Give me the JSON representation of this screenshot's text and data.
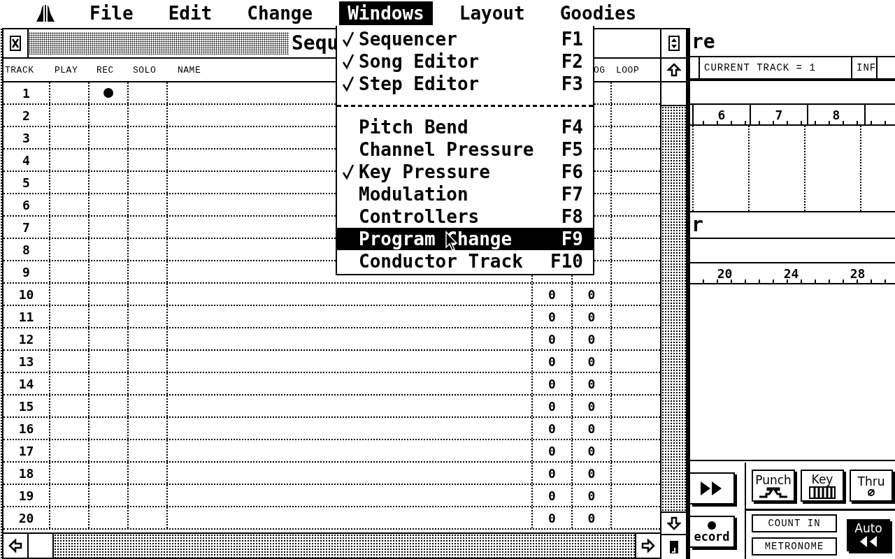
{
  "menubar": {
    "items": [
      {
        "label": "File",
        "selected": false
      },
      {
        "label": "Edit",
        "selected": false
      },
      {
        "label": "Change",
        "selected": false
      },
      {
        "label": "Windows",
        "selected": true
      },
      {
        "label": "Layout",
        "selected": false
      },
      {
        "label": "Goodies",
        "selected": false
      }
    ]
  },
  "windows_menu": {
    "items": [
      {
        "kind": "item",
        "label": "Sequencer",
        "shortcut": "F1",
        "checked": true,
        "selected": false
      },
      {
        "kind": "item",
        "label": "Song Editor",
        "shortcut": "F2",
        "checked": true,
        "selected": false
      },
      {
        "kind": "item",
        "label": "Step Editor",
        "shortcut": "F3",
        "checked": true,
        "selected": false
      },
      {
        "kind": "separator"
      },
      {
        "kind": "item",
        "label": "Pitch Bend",
        "shortcut": "F4",
        "checked": false,
        "selected": false
      },
      {
        "kind": "item",
        "label": "Channel Pressure",
        "shortcut": "F5",
        "checked": false,
        "selected": false
      },
      {
        "kind": "item",
        "label": "Key Pressure",
        "shortcut": "F6",
        "checked": true,
        "selected": false
      },
      {
        "kind": "item",
        "label": "Modulation",
        "shortcut": "F7",
        "checked": false,
        "selected": false
      },
      {
        "kind": "item",
        "label": "Controllers",
        "shortcut": "F8",
        "checked": false,
        "selected": false
      },
      {
        "kind": "item",
        "label": "Program Change",
        "shortcut": "F9",
        "checked": false,
        "selected": true
      },
      {
        "kind": "item",
        "label": "Conductor Track",
        "shortcut": "F10",
        "checked": false,
        "selected": false
      }
    ]
  },
  "sequencer": {
    "title": "Sequ",
    "headers": {
      "track": "TRACK",
      "play": "PLAY",
      "rec": "REC",
      "solo": "SOLO",
      "name": "NAME",
      "column_7": "OG",
      "loop": "LOOP"
    },
    "rows": [
      {
        "track": "1",
        "rec": true
      },
      {
        "track": "2",
        "rec": false
      },
      {
        "track": "3",
        "rec": false
      },
      {
        "track": "4",
        "rec": false
      },
      {
        "track": "5",
        "rec": false
      },
      {
        "track": "6",
        "rec": false
      },
      {
        "track": "7",
        "rec": false
      },
      {
        "track": "8",
        "rec": false
      },
      {
        "track": "9",
        "rec": false
      },
      {
        "track": "10",
        "rec": false,
        "column_6": "0",
        "column_7": "0"
      },
      {
        "track": "11",
        "rec": false,
        "column_6": "0",
        "column_7": "0"
      },
      {
        "track": "12",
        "rec": false,
        "column_6": "0",
        "column_7": "0"
      },
      {
        "track": "13",
        "rec": false,
        "column_6": "0",
        "column_7": "0"
      },
      {
        "track": "14",
        "rec": false,
        "column_6": "0",
        "column_7": "0"
      },
      {
        "track": "15",
        "rec": false,
        "column_6": "0",
        "column_7": "0"
      },
      {
        "track": "16",
        "rec": false,
        "column_6": "0",
        "column_7": "0"
      },
      {
        "track": "17",
        "rec": false,
        "column_6": "0",
        "column_7": "0"
      },
      {
        "track": "18",
        "rec": false,
        "column_6": "0",
        "column_7": "0"
      },
      {
        "track": "19",
        "rec": false,
        "column_6": "0",
        "column_7": "0"
      },
      {
        "track": "20",
        "rec": false,
        "column_6": "0",
        "column_7": "0"
      }
    ]
  },
  "song_window": {
    "title": "re",
    "info": "CURRENT TRACK = 1",
    "info_2": "INF",
    "ruler": [
      "6",
      "7",
      "8"
    ]
  },
  "second_window": {
    "title": "r",
    "ruler": [
      "20",
      "24",
      "28"
    ]
  },
  "transport": {
    "record_label": "ecord",
    "punch": {
      "label": "Punch",
      "on": false
    },
    "key": {
      "label": "Key",
      "on": false
    },
    "thru": {
      "label": "Thru",
      "on": false
    },
    "count_in": {
      "label": "COUNT IN",
      "on": false
    },
    "metronome": {
      "label": "METRONOME",
      "on": false
    },
    "auto": {
      "label": "Auto",
      "on": true
    }
  }
}
